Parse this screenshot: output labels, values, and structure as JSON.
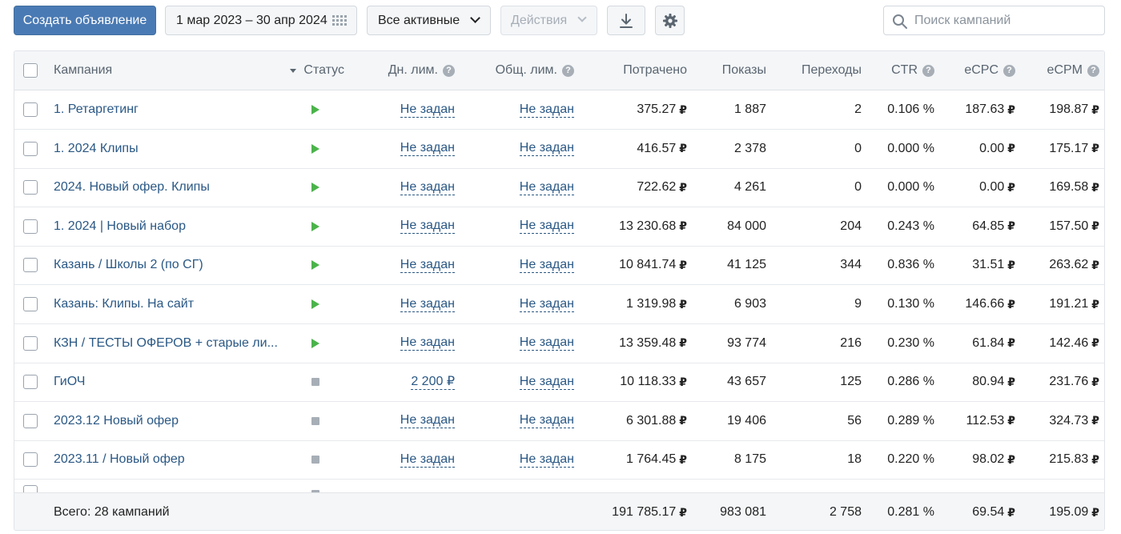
{
  "toolbar": {
    "create_label": "Создать объявление",
    "date_range": "1 мар 2023 – 30 апр 2024",
    "filter_label": "Все активные",
    "actions_label": "Действия",
    "search_placeholder": "Поиск кампаний"
  },
  "colors": {
    "accent": "#4a7ab4",
    "link": "#2a5885",
    "status_active": "#4bb34b",
    "status_stopped": "#a7aeb6"
  },
  "icons": [
    "calendar-icon",
    "chevron-down-icon",
    "download-icon",
    "gear-icon",
    "search-icon",
    "help-icon",
    "play-icon",
    "stop-icon",
    "sort-arrow-icon"
  ],
  "table": {
    "headers": {
      "campaign": "Кампания",
      "status": "Статус",
      "day_limit": "Дн. лим.",
      "total_limit": "Общ. лим.",
      "spent": "Потрачено",
      "shows": "Показы",
      "clicks": "Переходы",
      "ctr": "CTR",
      "ecpc": "eCPC",
      "ecpm": "eCPM"
    },
    "currency": "₽",
    "rows": [
      {
        "name": "1. Ретаргетинг",
        "status": "active",
        "day_limit": "Не задан",
        "total_limit": "Не задан",
        "spent": "375.27",
        "shows": "1 887",
        "clicks": "2",
        "ctr": "0.106 %",
        "ecpc": "187.63",
        "ecpm": "198.87"
      },
      {
        "name": "1. 2024 Клипы",
        "status": "active",
        "day_limit": "Не задан",
        "total_limit": "Не задан",
        "spent": "416.57",
        "shows": "2 378",
        "clicks": "0",
        "ctr": "0.000 %",
        "ecpc": "0.00",
        "ecpm": "175.17"
      },
      {
        "name": "2024. Новый офер. Клипы",
        "status": "active",
        "day_limit": "Не задан",
        "total_limit": "Не задан",
        "spent": "722.62",
        "shows": "4 261",
        "clicks": "0",
        "ctr": "0.000 %",
        "ecpc": "0.00",
        "ecpm": "169.58"
      },
      {
        "name": "1. 2024 | Новый набор",
        "status": "active",
        "day_limit": "Не задан",
        "total_limit": "Не задан",
        "spent": "13 230.68",
        "shows": "84 000",
        "clicks": "204",
        "ctr": "0.243 %",
        "ecpc": "64.85",
        "ecpm": "157.50"
      },
      {
        "name": "Казань / Школы 2 (по СГ)",
        "status": "active",
        "day_limit": "Не задан",
        "total_limit": "Не задан",
        "spent": "10 841.74",
        "shows": "41 125",
        "clicks": "344",
        "ctr": "0.836 %",
        "ecpc": "31.51",
        "ecpm": "263.62"
      },
      {
        "name": "Казань: Клипы. На сайт",
        "status": "active",
        "day_limit": "Не задан",
        "total_limit": "Не задан",
        "spent": "1 319.98",
        "shows": "6 903",
        "clicks": "9",
        "ctr": "0.130 %",
        "ecpc": "146.66",
        "ecpm": "191.21"
      },
      {
        "name": "КЗН / ТЕСТЫ ОФЕРОВ + старые ли...",
        "status": "active",
        "day_limit": "Не задан",
        "total_limit": "Не задан",
        "spent": "13 359.48",
        "shows": "93 774",
        "clicks": "216",
        "ctr": "0.230 %",
        "ecpc": "61.84",
        "ecpm": "142.46"
      },
      {
        "name": "ГиОЧ",
        "status": "stopped",
        "day_limit": "2 200 ₽",
        "total_limit": "Не задан",
        "spent": "10 118.33",
        "shows": "43 657",
        "clicks": "125",
        "ctr": "0.286 %",
        "ecpc": "80.94",
        "ecpm": "231.76"
      },
      {
        "name": "2023.12 Новый офер",
        "status": "stopped",
        "day_limit": "Не задан",
        "total_limit": "Не задан",
        "spent": "6 301.88",
        "shows": "19 406",
        "clicks": "56",
        "ctr": "0.289 %",
        "ecpc": "112.53",
        "ecpm": "324.73"
      },
      {
        "name": "2023.11 / Новый офер",
        "status": "stopped",
        "day_limit": "Не задан",
        "total_limit": "Не задан",
        "spent": "1 764.45",
        "shows": "8 175",
        "clicks": "18",
        "ctr": "0.220 %",
        "ecpc": "98.02",
        "ecpm": "215.83"
      }
    ],
    "footer": {
      "label": "Всего: 28 кампаний",
      "spent": "191 785.17",
      "shows": "983 081",
      "clicks": "2 758",
      "ctr": "0.281 %",
      "ecpc": "69.54",
      "ecpm": "195.09"
    }
  }
}
